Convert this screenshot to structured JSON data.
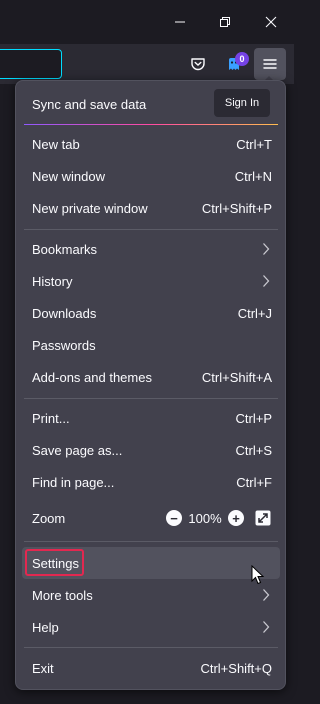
{
  "window": {
    "controls": [
      "minimize-icon",
      "maximize-icon",
      "close-icon"
    ]
  },
  "toolbar": {
    "url_value": "",
    "pocket_icon": "pocket-icon",
    "extension_icon": "extension-icon",
    "extension_badge": "0",
    "menu_icon": "hamburger-menu-icon"
  },
  "menu": {
    "sync": {
      "label": "Sync and save data",
      "sign_in": "Sign In"
    },
    "groups": [
      {
        "items": [
          {
            "label": "New tab",
            "shortcut": "Ctrl+T"
          },
          {
            "label": "New window",
            "shortcut": "Ctrl+N"
          },
          {
            "label": "New private window",
            "shortcut": "Ctrl+Shift+P"
          }
        ]
      },
      {
        "items": [
          {
            "label": "Bookmarks",
            "submenu": true
          },
          {
            "label": "History",
            "submenu": true
          },
          {
            "label": "Downloads",
            "shortcut": "Ctrl+J"
          },
          {
            "label": "Passwords",
            "shortcut": ""
          },
          {
            "label": "Add-ons and themes",
            "shortcut": "Ctrl+Shift+A"
          }
        ]
      },
      {
        "items": [
          {
            "label": "Print...",
            "shortcut": "Ctrl+P"
          },
          {
            "label": "Save page as...",
            "shortcut": "Ctrl+S"
          },
          {
            "label": "Find in page...",
            "shortcut": "Ctrl+F"
          }
        ]
      }
    ],
    "zoom": {
      "label": "Zoom",
      "minus": "−",
      "value": "100%",
      "plus": "+"
    },
    "settings": {
      "label": "Settings"
    },
    "more_tools": {
      "label": "More tools"
    },
    "help": {
      "label": "Help"
    },
    "exit": {
      "label": "Exit",
      "shortcut": "Ctrl+Shift+Q"
    }
  },
  "colors": {
    "panel_bg": "#42414d",
    "highlight_outline": "#e22850",
    "url_focus": "#00ddff",
    "badge": "#7542e5"
  }
}
